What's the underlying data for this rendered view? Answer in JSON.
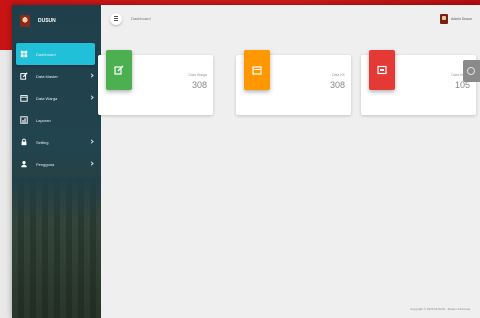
{
  "brand": {
    "name": "DUSUN"
  },
  "header": {
    "page_title": "Dashboard",
    "user_name": "Admin Dusun"
  },
  "sidebar": {
    "items": [
      {
        "label": "Dashboard",
        "icon": "dashboard-icon",
        "active": true,
        "has_submenu": false
      },
      {
        "label": "Data Master",
        "icon": "edit-icon",
        "active": false,
        "has_submenu": true
      },
      {
        "label": "Data Warga",
        "icon": "calendar-icon",
        "active": false,
        "has_submenu": true
      },
      {
        "label": "Laporan",
        "icon": "chart-icon",
        "active": false,
        "has_submenu": false
      },
      {
        "label": "Setting",
        "icon": "lock-icon",
        "active": false,
        "has_submenu": true
      },
      {
        "label": "Pengguna",
        "icon": "user-icon",
        "active": false,
        "has_submenu": true
      }
    ]
  },
  "cards": [
    {
      "label": "Data Warga",
      "value": "308",
      "color": "#4caf50",
      "icon": "edit-icon"
    },
    {
      "label": "Data KK",
      "value": "308",
      "color": "#ff9800",
      "icon": "calendar-icon"
    },
    {
      "label": "Data Mutasi",
      "value": "105",
      "color": "#e53935",
      "icon": "chart-icon"
    }
  ],
  "footer": {
    "text": "Copyright © 2020 DUSUN - Sistem Informasi"
  },
  "colors": {
    "sidebar_bg": "#1f3f4a",
    "accent": "#20c0d8",
    "topband": "#c81414"
  }
}
